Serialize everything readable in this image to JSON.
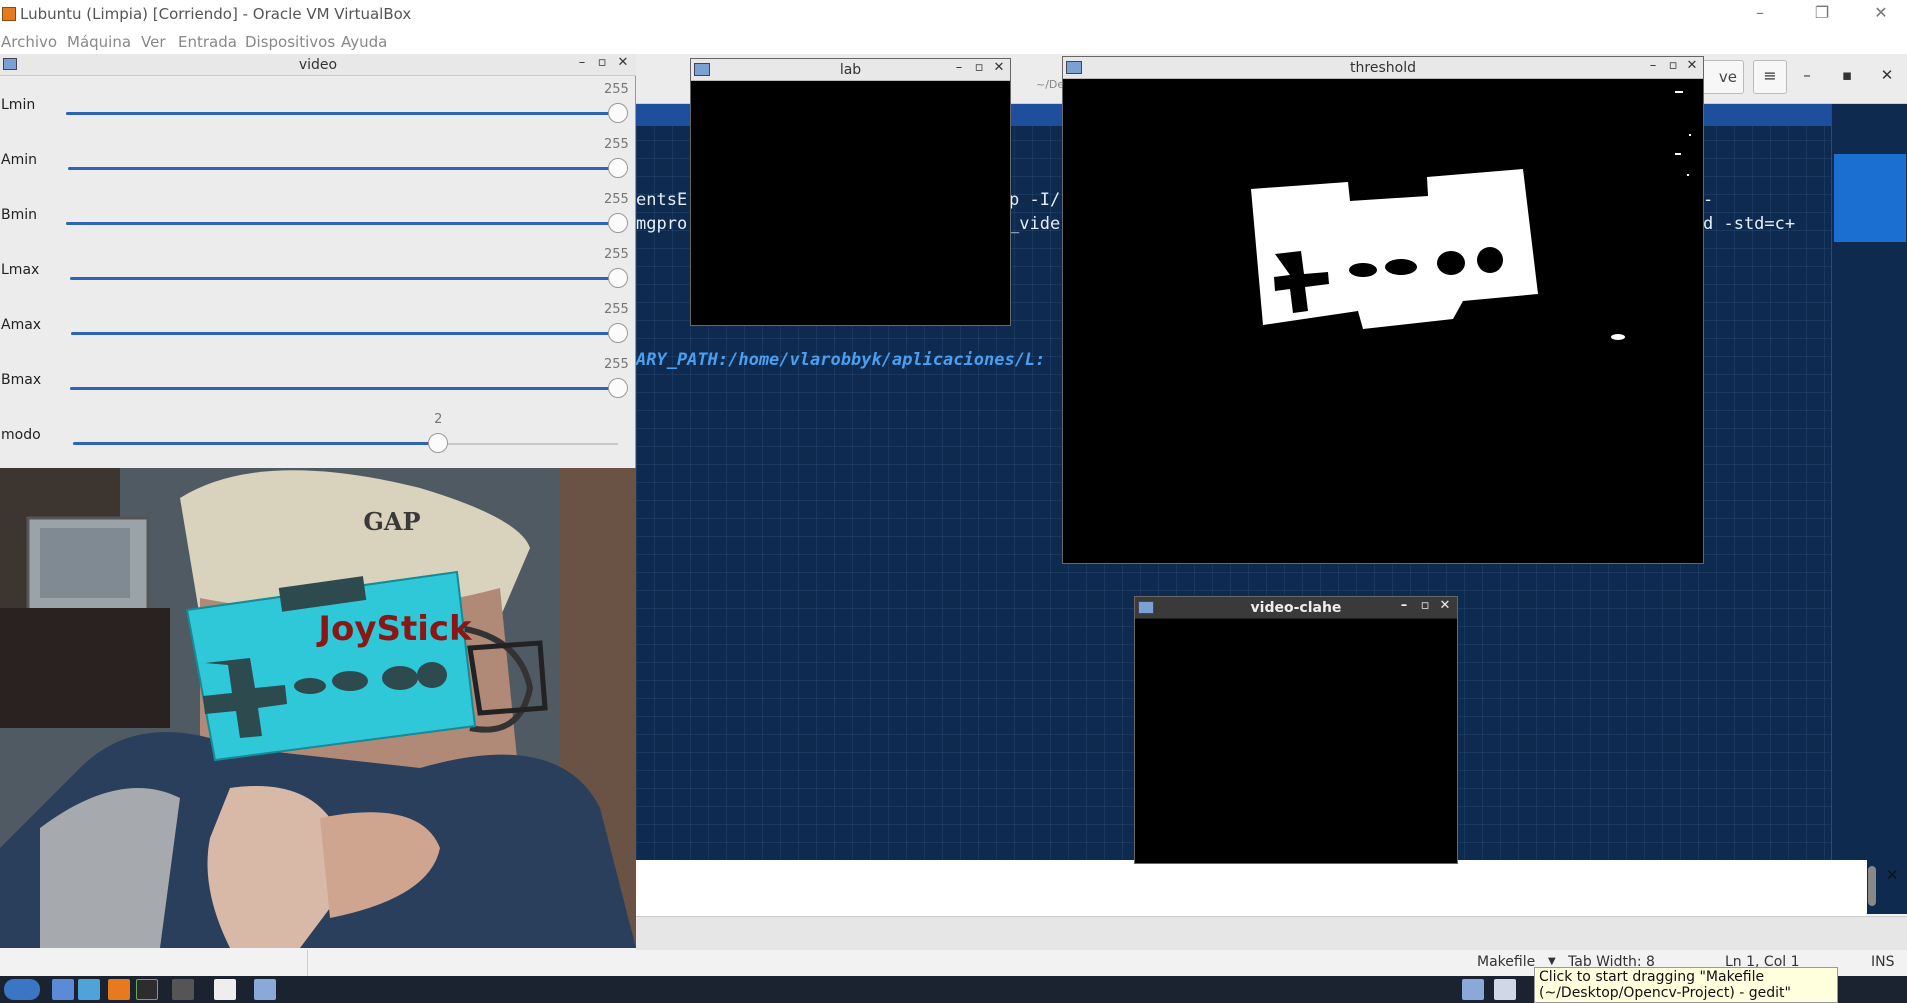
{
  "host": {
    "title": "Lubuntu (Limpia) [Corriendo] - Oracle VM VirtualBox",
    "menu": [
      "Archivo",
      "Máquina",
      "Ver",
      "Entrada",
      "Dispositivos",
      "Ayuda"
    ],
    "controls": {
      "minimize": "–",
      "restore": "❐",
      "close": "✕"
    }
  },
  "gedit": {
    "path": "~/De",
    "save_label": "ve",
    "menu_icon": "≡",
    "controls": {
      "minimize": "–",
      "maximize": "▪",
      "close": "✕"
    },
    "code_lines": [
      "entsE",
      "mgpro",
      "p -I/",
      "_vide",
      "-",
      "d -std=c+",
      "ARY_PATH:/home/vlarobbyk/aplicaciones/L:"
    ],
    "lower_close": "✕",
    "status": {
      "language": "Makefile",
      "tab_width": "Tab Width: 8",
      "position": "Ln 1, Col 1",
      "mode": "INS"
    }
  },
  "video_window": {
    "title": "video",
    "sliders": [
      {
        "name": "Lmin",
        "value": "255",
        "fraction": 1.0
      },
      {
        "name": "Amin",
        "value": "255",
        "fraction": 1.0
      },
      {
        "name": "Bmin",
        "value": "255",
        "fraction": 1.0
      },
      {
        "name": "Lmax",
        "value": "255",
        "fraction": 1.0
      },
      {
        "name": "Amax",
        "value": "255",
        "fraction": 1.0
      },
      {
        "name": "Bmax",
        "value": "255",
        "fraction": 1.0
      },
      {
        "name": "modo",
        "value": "2",
        "fraction": 0.67
      }
    ],
    "camera_text": "JoyStick",
    "cap_text": "GAP"
  },
  "windows": {
    "lab": {
      "title": "lab"
    },
    "threshold": {
      "title": "threshold"
    },
    "clahe": {
      "title": "video-clahe"
    }
  },
  "window_controls": {
    "minimize": "–",
    "maximize": "▫",
    "close": "✕"
  },
  "tooltip": "Click to start dragging \"Makefile (~/Desktop/Opencv-Project) - gedit\"",
  "colors": {
    "editor_bg": "#0e2a4f",
    "accent": "#2d64b5",
    "card": "#2fc8d8"
  }
}
